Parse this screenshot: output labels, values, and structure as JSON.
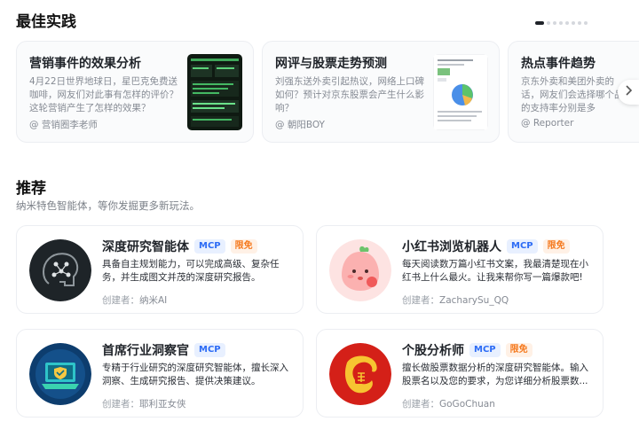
{
  "best_practice": {
    "title": "最佳实践",
    "cards": [
      {
        "title": "营销事件的效果分析",
        "desc": "4月22日世界地球日，星巴克免费送咖啡，网友们对此事有怎样的评价？这轮营销产生了怎样的效果？",
        "author": "@ 营销圈李老师"
      },
      {
        "title": "网评与股票走势预测",
        "desc": "刘强东送外卖引起热议，网络上口碑如何？预计对京东股票会产生什么影响？",
        "author": "@ 朝阳BOY"
      },
      {
        "title": "热点事件趋势",
        "desc": "京东外卖和美团外卖的话，网友们会选择哪个品的支持率分别是多",
        "author": "@ Reporter"
      }
    ],
    "next_icon": "chevron-right-icon"
  },
  "recommend": {
    "title": "推荐",
    "subtitle": "纳米特色智能体，等你发掘更多新玩法。",
    "creator_label": "创建者：",
    "tag_mcp": "MCP",
    "tag_free": "限免",
    "agents": [
      {
        "name": "深度研究智能体",
        "desc": "具备自主规划能力，可以完成高级、复杂任务，并生成图文并茂的深度研究报告。",
        "creator": "纳米AI",
        "icon": "brain-network-icon"
      },
      {
        "name": "小红书浏览机器人",
        "desc": "每天阅读数万篇小红书文案，我最清楚现在小红书上什么最火。让我来帮你写一篇爆款吧!",
        "creator": "ZacharySu_QQ",
        "icon": "peach-mascot-icon"
      },
      {
        "name": "首席行业洞察官",
        "desc": "专精于行业研究的深度研究智能体，擅长深入洞察、生成研究报告、提供决策建议。",
        "creator": "耶利亚女侠",
        "icon": "laptop-shield-icon"
      },
      {
        "name": "个股分析师",
        "desc": "擅长做股票数据分析的深度研究智能体。输入股票名以及您的要求，为您详细分析股票数...",
        "creator": "GoGoChuan",
        "icon": "dragon-stock-icon"
      }
    ]
  },
  "colors": {
    "mcp_tag": "#2d6cf5",
    "free_tag": "#f57a1f",
    "avatar1_bg": "#1e2428",
    "avatar4_bg": "#d42018"
  }
}
